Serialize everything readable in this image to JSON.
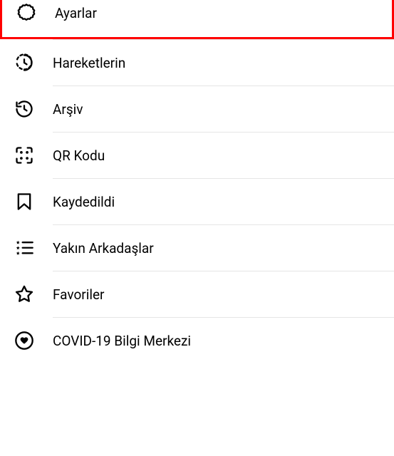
{
  "menu": {
    "items": [
      {
        "label": "Ayarlar"
      },
      {
        "label": "Hareketlerin"
      },
      {
        "label": "Arşiv"
      },
      {
        "label": "QR Kodu"
      },
      {
        "label": "Kaydedildi"
      },
      {
        "label": "Yakın Arkadaşlar"
      },
      {
        "label": "Favoriler"
      },
      {
        "label": "COVID-19 Bilgi Merkezi"
      }
    ]
  }
}
